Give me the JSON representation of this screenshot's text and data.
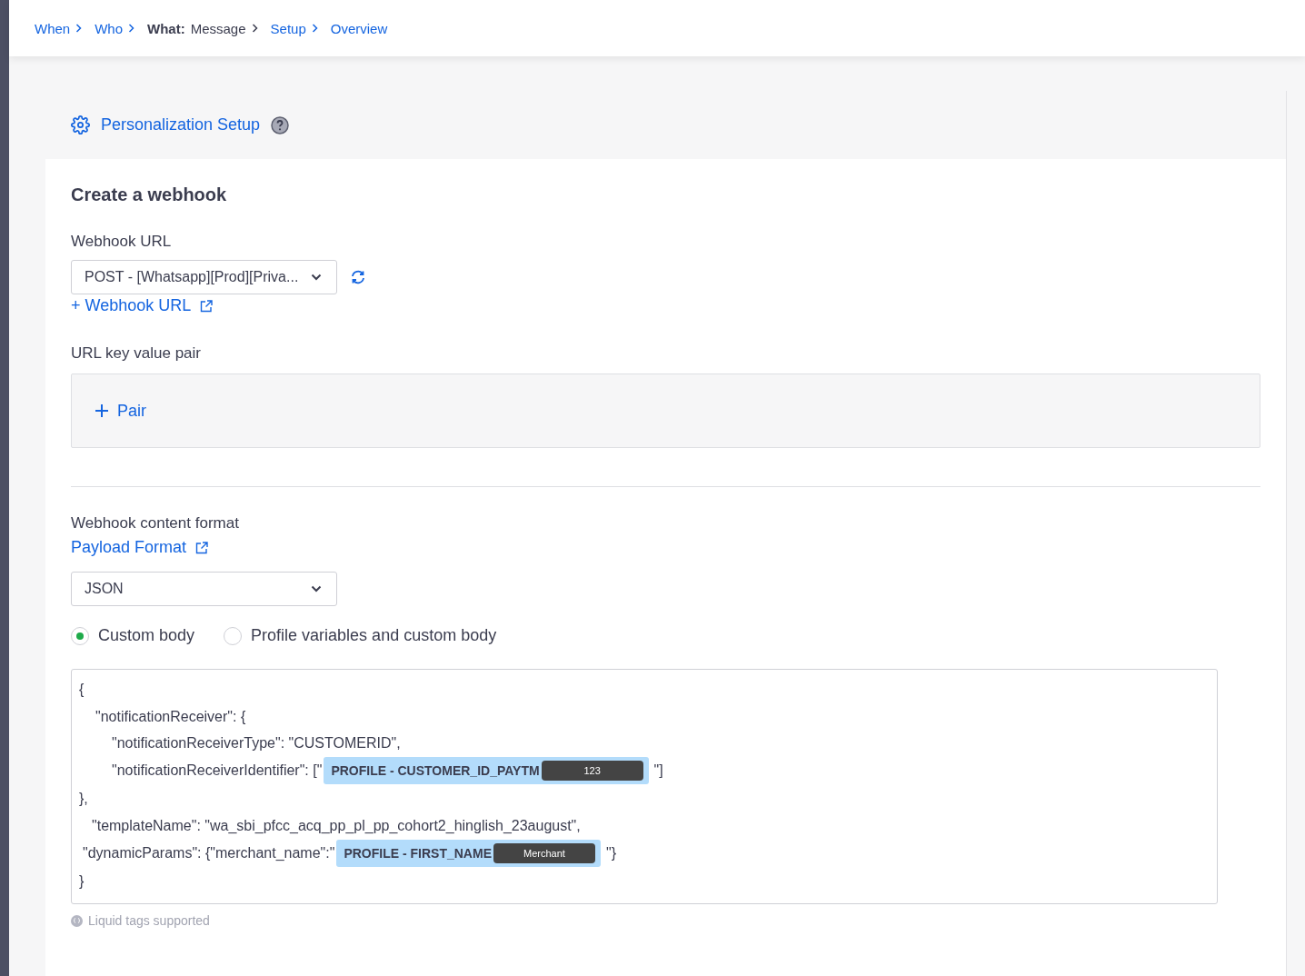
{
  "breadcrumbs": [
    {
      "label": "When",
      "kind": "link"
    },
    {
      "label": "Who",
      "kind": "link"
    },
    {
      "label": "What:",
      "value": "Message",
      "kind": "current"
    },
    {
      "label": "Setup",
      "kind": "link"
    },
    {
      "label": "Overview",
      "kind": "last"
    }
  ],
  "section_title": "Personalization Setup",
  "heading": "Create a webhook",
  "webhook_url": {
    "label": "Webhook URL",
    "value": "POST - [Whatsapp][Prod][Priva...",
    "add_link": "+ Webhook URL"
  },
  "url_pairs": {
    "label": "URL key value pair",
    "add_button": "Pair"
  },
  "content_format": {
    "label": "Webhook content format",
    "link": "Payload Format",
    "value": "JSON"
  },
  "body_options": [
    {
      "label": "Custom body",
      "selected": true
    },
    {
      "label": "Profile variables and custom body",
      "selected": false
    }
  ],
  "body_lines": [
    {
      "kind": "outer",
      "text": "{"
    },
    {
      "kind": "inner",
      "text": "\"notificationReceiver\": {"
    },
    {
      "kind": "deep",
      "text": "\"notificationReceiverType\": \"CUSTOMERID\","
    },
    {
      "kind": "deep",
      "text": "\"notificationReceiverIdentifier\": [\"",
      "tag": "PROFILE - CUSTOMER_ID_PAYTM",
      "sample": "123",
      "after": "\"]"
    },
    {
      "kind": "outer",
      "text": "},"
    },
    {
      "kind": "mid",
      "text": "\"templateName\": \"wa_sbi_pfcc_acq_pp_pl_pp_cohort2_hinglish_23august\","
    },
    {
      "kind": "near",
      "text": "\"dynamicParams\": {\"merchant_name\":\"",
      "tag": "PROFILE - FIRST_NAME",
      "sample": "Merchant",
      "after": "\"}"
    },
    {
      "kind": "outer",
      "text": "}"
    }
  ],
  "hint": "Liquid tags supported"
}
